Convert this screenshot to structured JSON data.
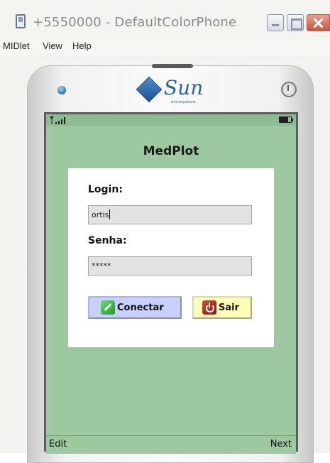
{
  "window": {
    "title": "+5550000 - DefaultColorPhone"
  },
  "menu": {
    "items": [
      "MIDlet",
      "View",
      "Help"
    ]
  },
  "device": {
    "brand_logo": "Sun",
    "brand_sub": "microsystems"
  },
  "screen": {
    "app_title": "MedPlot",
    "login": {
      "label": "Login:",
      "value": "ortis"
    },
    "password": {
      "label": "Senha:",
      "value": "*****"
    },
    "buttons": {
      "connect": "Conectar",
      "exit": "Sair"
    },
    "softkeys": {
      "left": "Edit",
      "right": "Next"
    }
  },
  "colors": {
    "screen_background": "#9dc8a0",
    "connect_button": "#c8d0ff",
    "exit_button": "#ffffb8"
  },
  "icons": [
    "app-window-icon",
    "minimize-icon",
    "maximize-icon",
    "close-icon",
    "led-icon",
    "power-icon",
    "sun-logo",
    "signal-icon",
    "battery-icon",
    "key-icon",
    "power-off-icon"
  ]
}
